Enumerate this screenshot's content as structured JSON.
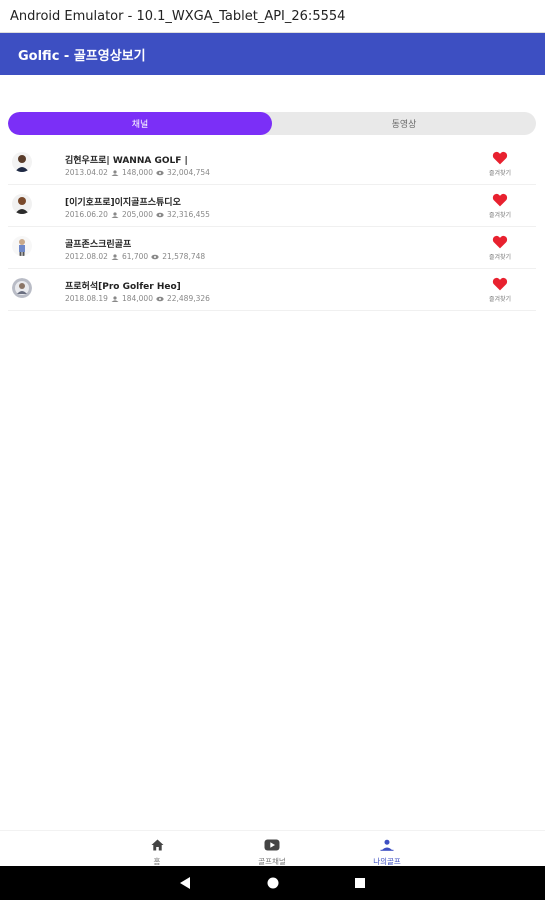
{
  "window": {
    "title": "Android Emulator - 10.1_WXGA_Tablet_API_26:5554"
  },
  "appbar": {
    "title": "Golfic - 골프영상보기"
  },
  "tabs": [
    {
      "label": "채널",
      "active": true
    },
    {
      "label": "동영상",
      "active": false
    }
  ],
  "channels": [
    {
      "name": "김현우프로| WANNA GOLF |",
      "date": "2013.04.02",
      "likes": "148,000",
      "views": "32,004,754",
      "fav_label": "즐겨찾기"
    },
    {
      "name": "[이기호프로]이지골프스튜디오",
      "date": "2016.06.20",
      "likes": "205,000",
      "views": "32,316,455",
      "fav_label": "즐겨찾기"
    },
    {
      "name": "골프존스크린골프",
      "date": "2012.08.02",
      "likes": "61,700",
      "views": "21,578,748",
      "fav_label": "즐겨찾기"
    },
    {
      "name": "프로허석[Pro Golfer Heo]",
      "date": "2018.08.19",
      "likes": "184,000",
      "views": "22,489,326",
      "fav_label": "즐겨찾기"
    }
  ],
  "bottom_nav": [
    {
      "label": "홈",
      "icon": "home-icon"
    },
    {
      "label": "골프채널",
      "icon": "youtube-icon"
    },
    {
      "label": "나의골프",
      "icon": "person-icon",
      "active": true
    }
  ],
  "colors": {
    "appbar": "#3d4fc2",
    "tab_active": "#7b2ff7",
    "heart": "#e8212f"
  }
}
